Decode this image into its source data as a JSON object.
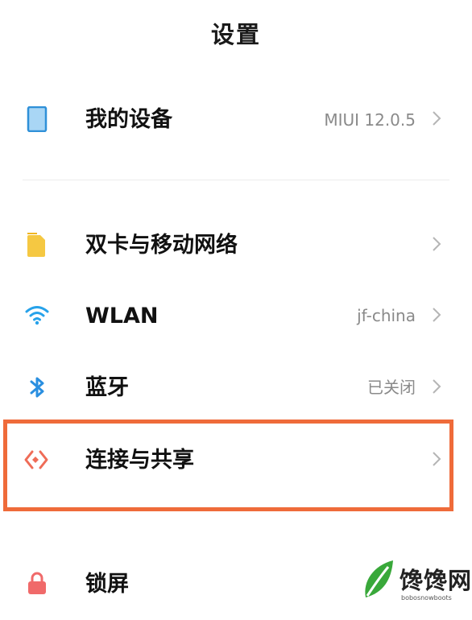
{
  "header": {
    "title": "设置"
  },
  "items": [
    {
      "label": "我的设备",
      "value": "MIUI 12.0.5",
      "icon": "device-icon"
    },
    {
      "label": "双卡与移动网络",
      "value": "",
      "icon": "sim-card-icon"
    },
    {
      "label": "WLAN",
      "value": "jf-china",
      "icon": "wifi-icon"
    },
    {
      "label": "蓝牙",
      "value": "已关闭",
      "icon": "bluetooth-icon"
    },
    {
      "label": "连接与共享",
      "value": "",
      "icon": "connection-share-icon"
    },
    {
      "label": "锁屏",
      "value": "",
      "icon": "lock-icon"
    }
  ],
  "highlight": {
    "color": "#ef6b3a"
  },
  "watermark": {
    "text": "馋馋网",
    "sub": "bobosnowboots"
  }
}
